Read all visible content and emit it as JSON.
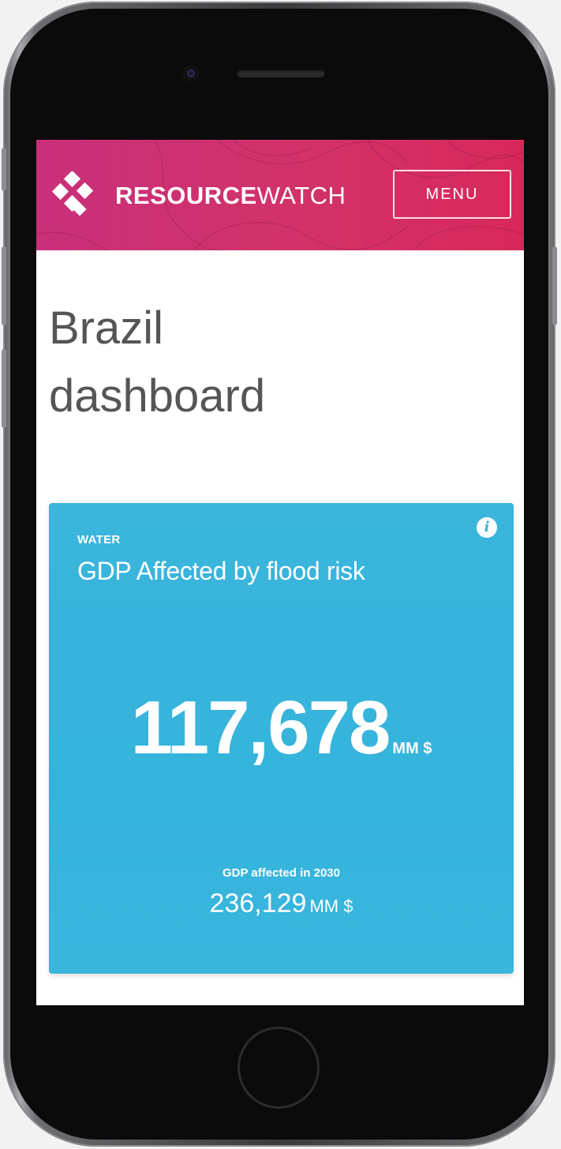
{
  "header": {
    "brand_bold": "RESOURCE",
    "brand_light": "WATCH",
    "menu_label": "MENU"
  },
  "page": {
    "title_line1": "Brazil",
    "title_line2": "dashboard"
  },
  "card": {
    "category": "WATER",
    "title": "GDP Affected by flood risk",
    "main_value": "117,678",
    "main_unit": "MM $",
    "sub_label": "GDP affected in 2030",
    "sub_value": "236,129",
    "sub_unit": "MM $",
    "info_icon": "info-icon",
    "background_color": "#39b5dc"
  },
  "colors": {
    "header_start": "#c9307a",
    "header_end": "#d8285a",
    "card": "#39b5dc"
  }
}
